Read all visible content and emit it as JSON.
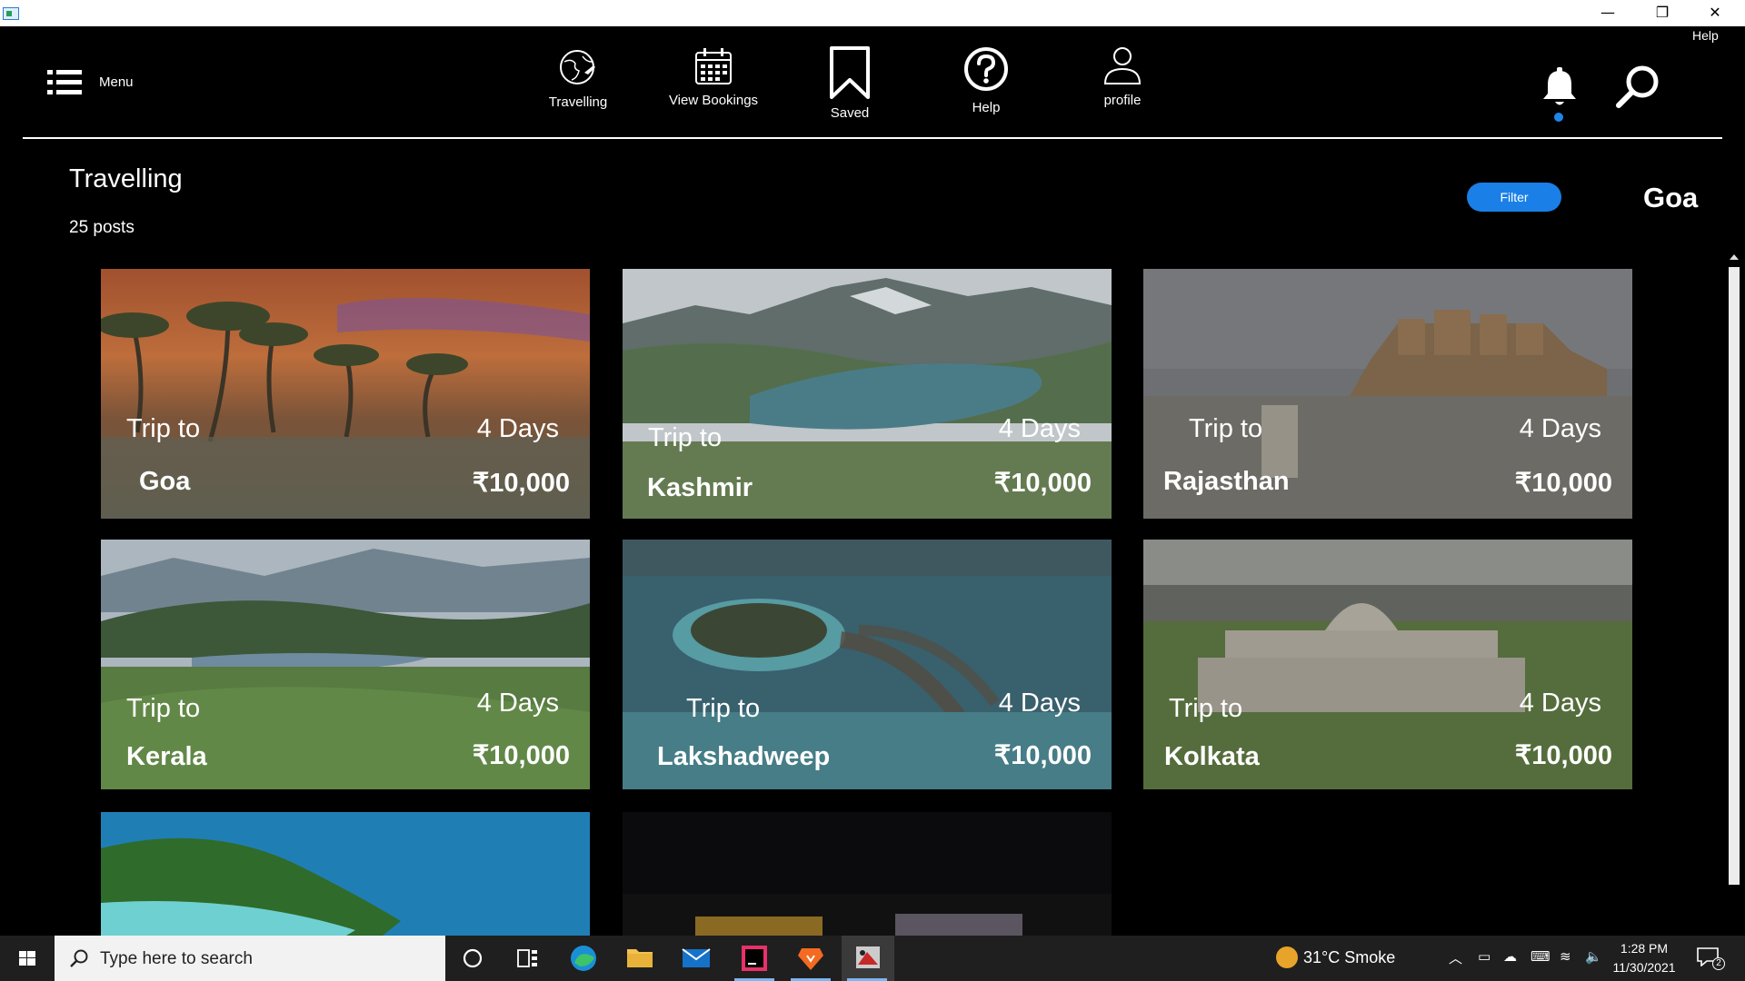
{
  "window": {
    "minimize_glyph": "—",
    "maximize_glyph": "❐",
    "close_glyph": "✕",
    "help_label": "Help"
  },
  "nav": {
    "menu_label": "Menu",
    "items": [
      {
        "label": "Travelling",
        "icon": "globe-plane-icon"
      },
      {
        "label": "View Bookings",
        "icon": "calendar-icon"
      },
      {
        "label": "Saved",
        "icon": "bookmark-icon"
      },
      {
        "label": "Help",
        "icon": "question-circle-icon"
      },
      {
        "label": "profile",
        "icon": "user-icon"
      }
    ],
    "notification_icon": "bell-icon",
    "search_icon": "search-icon"
  },
  "header": {
    "title": "Travelling",
    "post_count": "25 posts",
    "filter_label": "Filter",
    "location": "Goa"
  },
  "cards": [
    {
      "trip_label": "Trip to",
      "destination": "Goa",
      "duration": "4 Days",
      "price": "₹10,000"
    },
    {
      "trip_label": "Trip to",
      "destination": "Kashmir",
      "duration": "4 Days",
      "price": "₹10,000"
    },
    {
      "trip_label": "Trip to",
      "destination": "Rajasthan",
      "duration": "4 Days",
      "price": "₹10,000"
    },
    {
      "trip_label": "Trip to",
      "destination": "Kerala",
      "duration": "4 Days",
      "price": "₹10,000"
    },
    {
      "trip_label": "Trip to",
      "destination": "Lakshadweep",
      "duration": "4 Days",
      "price": "₹10,000"
    },
    {
      "trip_label": "Trip to",
      "destination": "Kolkata",
      "duration": "4 Days",
      "price": "₹10,000"
    }
  ],
  "taskbar": {
    "search_placeholder": "Type here to search",
    "weather": "31°C  Smoke",
    "time": "1:28 PM",
    "date": "11/30/2021",
    "notification_count": "2",
    "accent_color": "#1a7fe6"
  }
}
